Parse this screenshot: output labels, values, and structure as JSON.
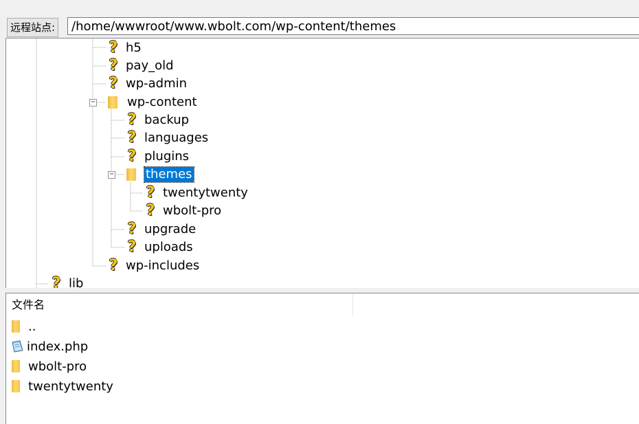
{
  "path_bar": {
    "label": "远程站点:",
    "path": "/home/wwwroot/www.wbolt.com/wp-content/themes"
  },
  "tree": {
    "items": [
      {
        "label": "h5",
        "icon": "question-icon"
      },
      {
        "label": "pay_old",
        "icon": "question-icon"
      },
      {
        "label": "wp-admin",
        "icon": "question-icon"
      },
      {
        "label": "wp-content",
        "icon": "folder-icon"
      },
      {
        "label": "backup",
        "icon": "question-icon"
      },
      {
        "label": "languages",
        "icon": "question-icon"
      },
      {
        "label": "plugins",
        "icon": "question-icon"
      },
      {
        "label": "themes",
        "icon": "folder-icon",
        "selected": true
      },
      {
        "label": "twentytwenty",
        "icon": "question-icon"
      },
      {
        "label": "wbolt-pro",
        "icon": "question-icon"
      },
      {
        "label": "upgrade",
        "icon": "question-icon"
      },
      {
        "label": "uploads",
        "icon": "question-icon"
      },
      {
        "label": "wp-includes",
        "icon": "question-icon"
      },
      {
        "label": "lib",
        "icon": "question-icon"
      }
    ]
  },
  "file_list": {
    "header": "文件名",
    "rows": [
      {
        "name": "..",
        "icon": "folder-icon"
      },
      {
        "name": "index.php",
        "icon": "php-file-icon"
      },
      {
        "name": "wbolt-pro",
        "icon": "folder-icon"
      },
      {
        "name": "twentytwenty",
        "icon": "folder-icon"
      }
    ]
  },
  "colors": {
    "selection": "#0078d7",
    "folder": "#f2c24e",
    "unknown_icon": "#f7c615"
  }
}
